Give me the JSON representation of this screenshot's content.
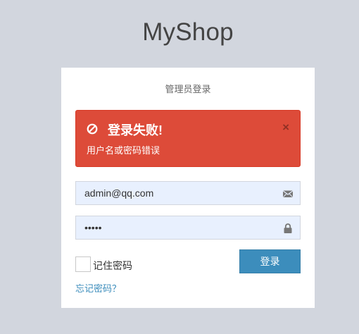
{
  "logo": "MyShop",
  "login": {
    "box_msg": "管理员登录",
    "alert": {
      "icon": "ban-icon",
      "title": "登录失败!",
      "message": "用户名或密码错误",
      "close": "×",
      "color": "#dd4b39"
    },
    "email": {
      "value": "admin@qq.com",
      "icon": "envelope-icon"
    },
    "password": {
      "value": "•••••",
      "icon": "lock-icon"
    },
    "remember_label": "记住密码",
    "remember_checked": false,
    "submit_label": "登录",
    "forgot_link": "忘记密码？"
  },
  "colors": {
    "background": "#d2d6de",
    "primary": "#3c8dbc",
    "danger": "#dd4b39",
    "input_fill": "#e8f0fe"
  }
}
